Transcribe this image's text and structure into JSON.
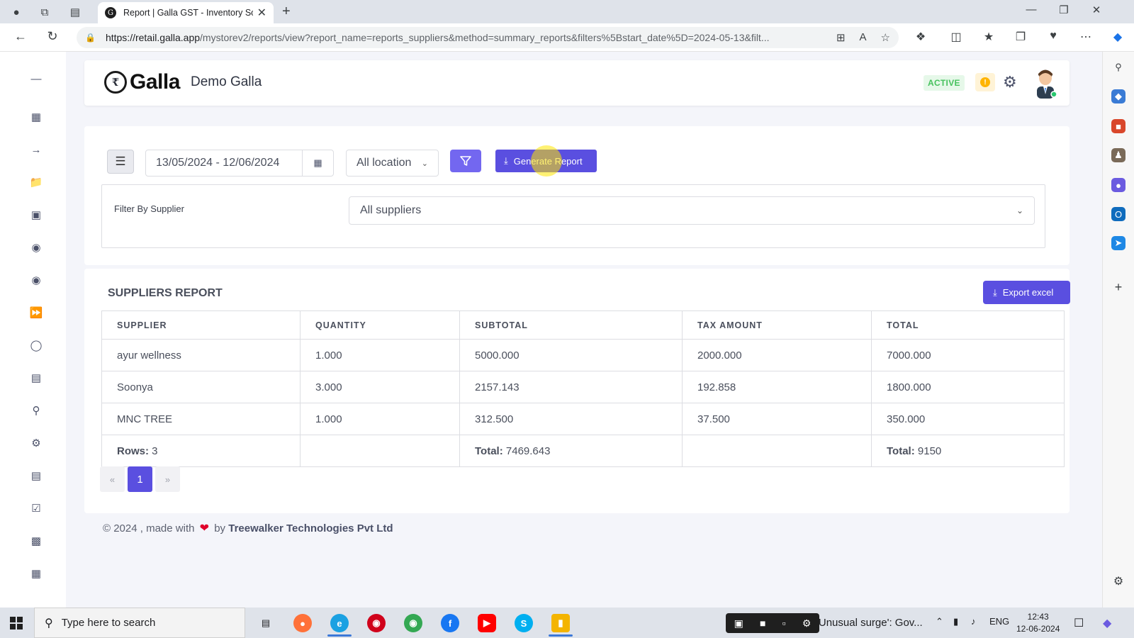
{
  "browser": {
    "tab_title": "Report | Galla GST - Inventory So",
    "url_domain": "https://retail.galla.app",
    "url_path": "/mystorev2/reports/view?report_name=reports_suppliers&method=summary_reports&filters%5Bstart_date%5D=2024-05-13&filt..."
  },
  "header": {
    "logo_text": "Galla",
    "store_name": "Demo Galla",
    "status_badge": "ACTIVE",
    "warning_glyph": "!"
  },
  "filters": {
    "date_range": "13/05/2024 - 12/06/2024",
    "location": "All location",
    "generate_label": "Generate Report",
    "supplier_filter_label": "Filter By Supplier",
    "supplier_value": "All suppliers"
  },
  "report": {
    "title": "SUPPLIERS REPORT",
    "export_label": "Export excel",
    "columns": [
      "SUPPLIER",
      "QUANTITY",
      "SUBTOTAL",
      "TAX AMOUNT",
      "TOTAL"
    ],
    "rows": [
      [
        "ayur wellness",
        "1.000",
        "5000.000",
        "2000.000",
        "7000.000"
      ],
      [
        "Soonya",
        "3.000",
        "2157.143",
        "192.858",
        "1800.000"
      ],
      [
        "MNC TREE",
        "1.000",
        "312.500",
        "37.500",
        "350.000"
      ]
    ],
    "summary": {
      "rows_label": "Rows:",
      "rows_value": "3",
      "subtotal_label": "Total:",
      "subtotal_value": "7469.643",
      "total_label": "Total:",
      "total_value": "9150"
    },
    "pagination": {
      "prev": "«",
      "current": "1",
      "next": "»"
    }
  },
  "footer": {
    "prefix": "© 2024 , made with",
    "by": "by",
    "company": "Treewalker Technologies Pvt Ltd"
  },
  "taskbar": {
    "search_placeholder": "Type here to search",
    "news": "'Unusual surge': Gov...",
    "lang": "ENG",
    "time": "12:43",
    "date": "12-06-2024"
  },
  "colors": {
    "primary": "#5a4fe0",
    "filter_button": "#7367f0",
    "active_green": "#47c25e",
    "heart": "#e0002a"
  }
}
